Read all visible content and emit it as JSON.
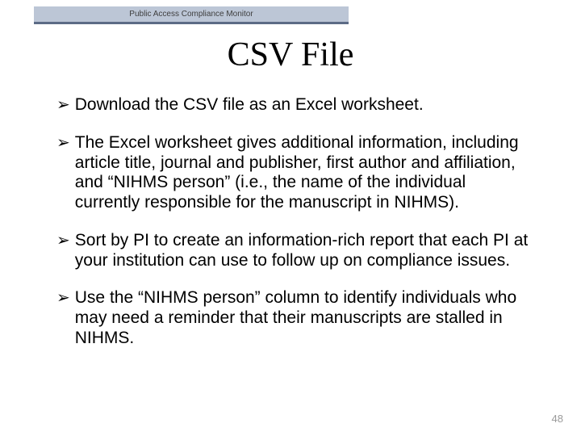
{
  "header": {
    "label": "Public Access Compliance Monitor"
  },
  "title": "CSV File",
  "bullets": [
    "Download the CSV file as an Excel worksheet.",
    "The Excel worksheet gives additional information, including article title, journal and publisher, first author and affiliation, and “NIHMS person” (i.e., the name of the individual currently responsible for the manuscript in NIHMS).",
    "Sort by PI to create an information-rich report that each PI at your institution can use to follow up on compliance issues.",
    "Use the “NIHMS person” column to identify individuals who may need a reminder that their manuscripts are stalled in NIHMS."
  ],
  "page_number": "48",
  "marker": "➢"
}
